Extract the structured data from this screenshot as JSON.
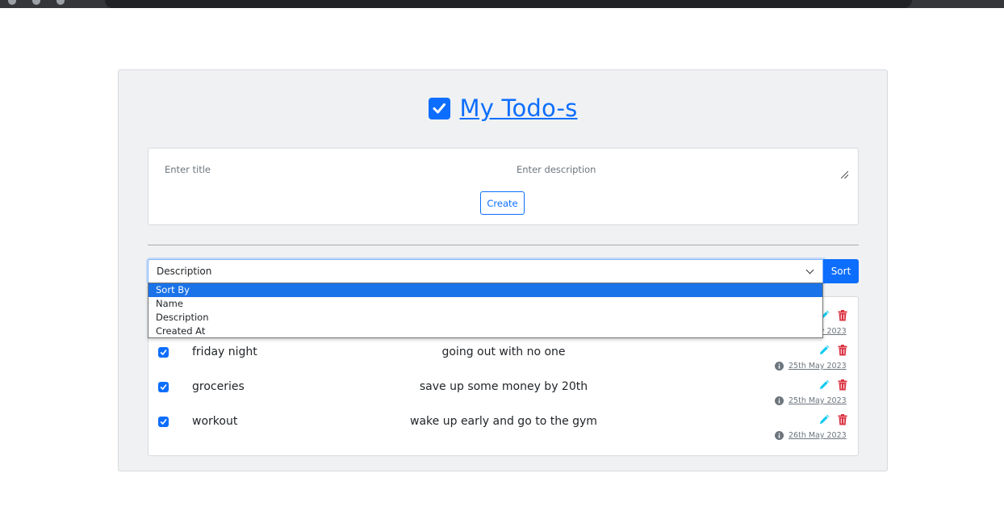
{
  "app": {
    "title": "My Todo-s"
  },
  "form": {
    "title_placeholder": "Enter title",
    "description_placeholder": "Enter description",
    "create_label": "Create"
  },
  "sort": {
    "selected": "Description",
    "button_label": "Sort",
    "options": [
      "Sort By",
      "Name",
      "Description",
      "Created At"
    ],
    "highlighted_option": "Sort By"
  },
  "todos": [
    {
      "name": "",
      "description": "",
      "created": "25th May 2023",
      "done": true
    },
    {
      "name": "friday night",
      "description": "going out with no one",
      "created": "25th May 2023",
      "done": true
    },
    {
      "name": "groceries",
      "description": "save up some money by 20th",
      "created": "25th May 2023",
      "done": true
    },
    {
      "name": "workout",
      "description": "wake up early and go to the gym",
      "created": "26th May 2023",
      "done": true
    }
  ],
  "colors": {
    "primary": "#0d6efd",
    "edit": "#0dcaf0",
    "delete": "#dc3545",
    "panel": "#eff1f3"
  }
}
